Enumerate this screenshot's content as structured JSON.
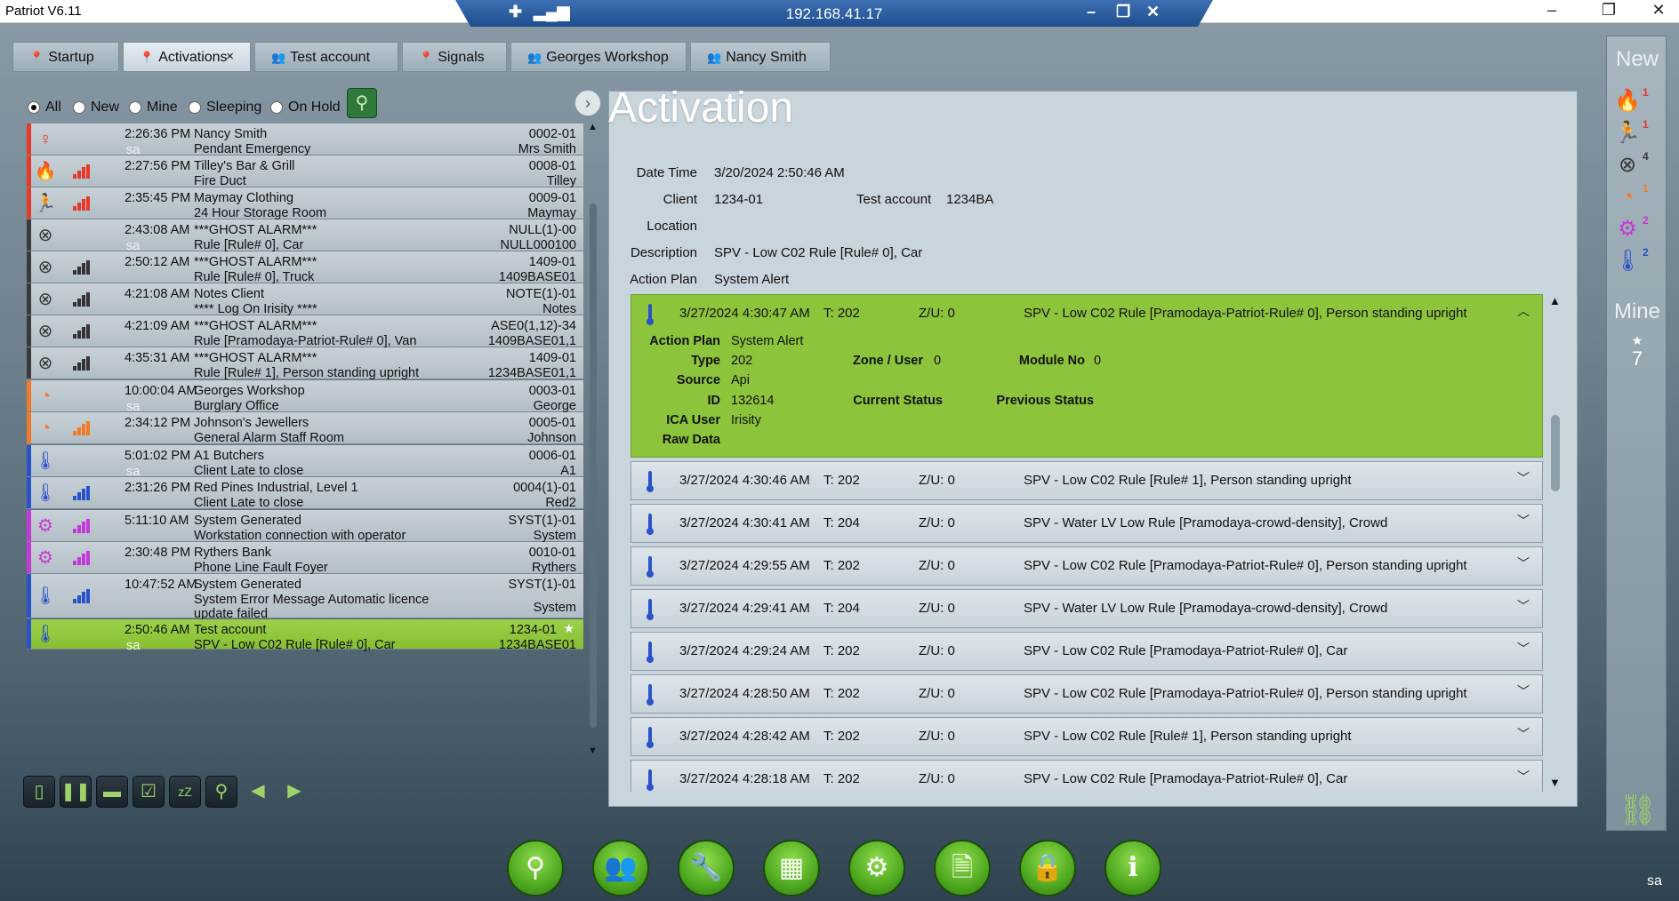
{
  "window": {
    "title": "Patriot V6.11",
    "remote_ip": "192.168.41.17"
  },
  "tabs": [
    {
      "label": "Startup",
      "icon": "pin-icon"
    },
    {
      "label": "Activations",
      "icon": "pin-icon",
      "close": "×"
    },
    {
      "label": "Test account",
      "icon": "person-icon"
    },
    {
      "label": "Signals",
      "icon": "pin-icon"
    },
    {
      "label": "Georges Workshop",
      "icon": "person-icon"
    },
    {
      "label": "Nancy Smith",
      "icon": "person-icon"
    }
  ],
  "filters": [
    {
      "label": "All",
      "selected": true
    },
    {
      "label": "New",
      "selected": false
    },
    {
      "label": "Mine",
      "selected": false
    },
    {
      "label": "Sleeping",
      "selected": false
    },
    {
      "label": "On Hold",
      "selected": false
    }
  ],
  "alarms": [
    {
      "time": "2:26:36 PM",
      "user": "sa",
      "name": "Nancy Smith",
      "desc": "Pendant Emergency",
      "acct": "0002-01",
      "sub": "Mrs Smith",
      "icon": "pendant-icon",
      "color": "#e6392c",
      "signal": false
    },
    {
      "time": "2:27:56 PM",
      "user": "",
      "name": "Tilley's Bar & Grill",
      "desc": "Fire Duct",
      "acct": "0008-01",
      "sub": "Tilley",
      "icon": "fire-icon",
      "color": "#e6392c",
      "signal": true
    },
    {
      "time": "2:35:45 PM",
      "user": "",
      "name": "Maymay Clothing",
      "desc": "24 Hour Storage Room",
      "acct": "0009-01",
      "sub": "Maymay",
      "icon": "intruder-icon",
      "color": "#e6392c",
      "signal": true
    },
    {
      "time": "2:43:08 AM",
      "user": "sa",
      "name": "***GHOST ALARM***",
      "desc": "Rule [Rule# 0], Car",
      "acct": "NULL(1)-00",
      "sub": "NULL000100",
      "icon": "ghost-icon",
      "color": "#3a3a3a",
      "signal": false
    },
    {
      "time": "2:50:12 AM",
      "user": "",
      "name": "***GHOST ALARM***",
      "desc": "Rule [Rule# 0], Truck",
      "acct": "1409-01",
      "sub": "1409BASE01",
      "icon": "ghost-icon",
      "color": "#3a3a3a",
      "signal": true
    },
    {
      "time": "4:21:08 AM",
      "user": "",
      "name": "Notes Client",
      "desc": "**** Log On Irisity ****",
      "acct": "NOTE(1)-01",
      "sub": "Notes",
      "icon": "ghost-icon",
      "color": "#3a3a3a",
      "signal": true
    },
    {
      "time": "4:21:09 AM",
      "user": "",
      "name": "***GHOST ALARM***",
      "desc": "Rule [Pramodaya-Patriot-Rule# 0], Van",
      "acct": "ASE0(1,12)-34",
      "sub": "1409BASE01,1",
      "icon": "ghost-icon",
      "color": "#3a3a3a",
      "signal": true
    },
    {
      "time": "4:35:31 AM",
      "user": "",
      "name": "***GHOST ALARM***",
      "desc": "Rule [Rule# 1], Person standing upright",
      "acct": "1409-01",
      "sub": "1234BASE01,1",
      "icon": "ghost-icon",
      "color": "#3a3a3a",
      "signal": true
    },
    {
      "time": "10:00:04 AM",
      "user": "sa",
      "name": "Georges Workshop",
      "desc": "Burglary Office",
      "acct": "0003-01",
      "sub": "George",
      "icon": "motion-icon",
      "color": "#f07a2a",
      "signal": false
    },
    {
      "time": "2:34:12 PM",
      "user": "",
      "name": "Johnson's Jewellers",
      "desc": "General Alarm Staff Room",
      "acct": "0005-01",
      "sub": "Johnson",
      "icon": "motion-icon",
      "color": "#f07a2a",
      "signal": true
    },
    {
      "time": "5:01:02 PM",
      "user": "sa",
      "name": "A1 Butchers",
      "desc": "Client Late to close",
      "acct": "0006-01",
      "sub": "A1",
      "icon": "thermometer-icon",
      "color": "#2a52c9",
      "signal": false
    },
    {
      "time": "2:31:26 PM",
      "user": "",
      "name": "Red Pines Industrial, Level 1",
      "desc": "Client Late to close",
      "acct": "0004(1)-01",
      "sub": "Red2",
      "icon": "thermometer-icon",
      "color": "#2a52c9",
      "signal": true
    },
    {
      "time": "5:11:10 AM",
      "user": "",
      "name": "System Generated",
      "desc": "Workstation connection with operator",
      "acct": "SYST(1)-01",
      "sub": "System",
      "icon": "system-gear-icon",
      "color": "#c43ad6",
      "signal": true
    },
    {
      "time": "2:30:48 PM",
      "user": "",
      "name": "Rythers Bank",
      "desc": "Phone Line Fault Foyer",
      "acct": "0010-01",
      "sub": "Rythers",
      "icon": "system-gear-icon",
      "color": "#c43ad6",
      "signal": true
    },
    {
      "time": "10:47:52 AM",
      "user": "",
      "name": "System Generated",
      "desc": "System Error Message  Automatic licence update failed",
      "acct": "SYST(1)-01",
      "sub": "System",
      "icon": "thermometer-icon",
      "color": "#2a52c9",
      "signal": true
    },
    {
      "time": "2:50:46 AM",
      "user": "sa",
      "name": "Test account",
      "desc": "SPV - Low C02 Rule [Rule# 0], Car",
      "acct": "1234-01",
      "sub": "1234BASE01",
      "icon": "thermometer-icon",
      "color": "#2a52c9",
      "signal": false,
      "selected": true
    }
  ],
  "activation": {
    "title": "Activation",
    "fields": {
      "date_time_label": "Date Time",
      "date_time": "3/20/2024 2:50:46 AM",
      "client_label": "Client",
      "client": "1234-01",
      "client_name": "Test account",
      "client_code": "1234BA",
      "location_label": "Location",
      "location": "",
      "description_label": "Description",
      "description": "SPV - Low C02 Rule [Rule# 0], Car",
      "action_plan_label": "Action Plan",
      "action_plan": "System Alert"
    },
    "expanded": {
      "date": "3/27/2024 4:30:47 AM",
      "type_short": "T:  202",
      "zu": "Z/U: 0",
      "message": "SPV - Low C02 Rule [Pramodaya-Patriot-Rule# 0], Person standing upright",
      "action_plan_label": "Action Plan",
      "action_plan": "System Alert",
      "type_label": "Type",
      "type": "202",
      "zone_label": "Zone / User",
      "zone": "0",
      "module_label": "Module No",
      "module": "0",
      "source_label": "Source",
      "source": "Api",
      "id_label": "ID",
      "id": "132614",
      "current_status_label": "Current Status",
      "previous_status_label": "Previous Status",
      "ica_user_label": "ICA User",
      "ica_user": "Irisity",
      "raw_data_label": "Raw Data"
    },
    "events": [
      {
        "date": "3/27/2024 4:30:46 AM",
        "t": "T:  202",
        "zu": "Z/U: 0",
        "msg": "SPV - Low C02 Rule [Rule# 1], Person standing upright"
      },
      {
        "date": "3/27/2024 4:30:41 AM",
        "t": "T:  204",
        "zu": "Z/U: 0",
        "msg": "SPV - Water LV Low Rule [Pramodaya-crowd-density], Crowd"
      },
      {
        "date": "3/27/2024 4:29:55 AM",
        "t": "T:  202",
        "zu": "Z/U: 0",
        "msg": "SPV - Low C02 Rule [Pramodaya-Patriot-Rule# 0], Person standing upright"
      },
      {
        "date": "3/27/2024 4:29:41 AM",
        "t": "T:  204",
        "zu": "Z/U: 0",
        "msg": "SPV - Water LV Low Rule [Pramodaya-crowd-density], Crowd"
      },
      {
        "date": "3/27/2024 4:29:24 AM",
        "t": "T:  202",
        "zu": "Z/U: 0",
        "msg": "SPV - Low C02 Rule [Pramodaya-Patriot-Rule# 0], Car"
      },
      {
        "date": "3/27/2024 4:28:50 AM",
        "t": "T:  202",
        "zu": "Z/U: 0",
        "msg": "SPV - Low C02 Rule [Pramodaya-Patriot-Rule# 0], Person standing upright"
      },
      {
        "date": "3/27/2024 4:28:42 AM",
        "t": "T:  202",
        "zu": "Z/U: 0",
        "msg": "SPV - Low C02 Rule [Rule# 1], Person standing upright"
      },
      {
        "date": "3/27/2024 4:28:18 AM",
        "t": "T:  202",
        "zu": "Z/U: 0",
        "msg": "SPV - Low C02 Rule [Pramodaya-Patriot-Rule# 0], Car"
      }
    ]
  },
  "sidebar": {
    "new_label": "New",
    "new_counts": [
      {
        "icon": "fire-icon",
        "count": "1",
        "color": "#e6392c"
      },
      {
        "icon": "intruder-icon",
        "count": "1",
        "color": "#e6392c"
      },
      {
        "icon": "ghost-icon",
        "count": "4",
        "color": "#3a3a3a"
      },
      {
        "icon": "motion-icon",
        "count": "1",
        "color": "#f07a2a"
      },
      {
        "icon": "system-gear-icon",
        "count": "2",
        "color": "#c43ad6"
      },
      {
        "icon": "thermometer-icon",
        "count": "2",
        "color": "#2a52c9"
      }
    ],
    "mine_label": "Mine",
    "mine_count": "7"
  },
  "toolbar_left": [
    "phone-icon",
    "pause-icon",
    "minus-icon",
    "checklist-icon",
    "sleep-icon",
    "search-icon",
    "back-arrow-icon",
    "forward-arrow-icon"
  ],
  "dock": [
    "alarm-icon",
    "users-icon",
    "wrench-icon",
    "calculator-icon",
    "settings-icon",
    "report-icon",
    "lock-icon",
    "info-icon"
  ],
  "user_initials": "sa"
}
